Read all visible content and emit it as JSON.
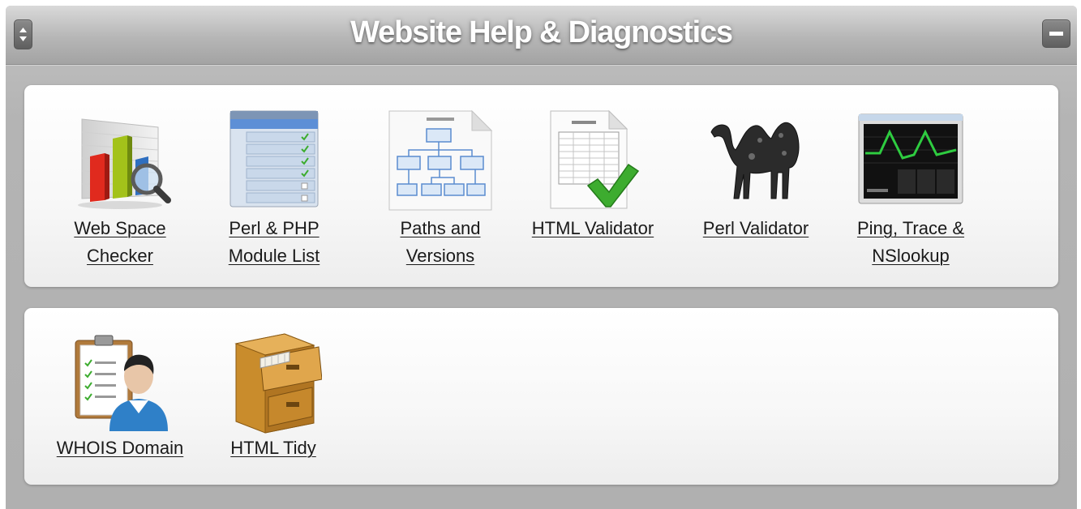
{
  "header": {
    "title": "Website Help & Diagnostics",
    "sort_icon": "up-down-arrows-icon",
    "minimize_icon": "minimize-icon"
  },
  "tools_row1": [
    {
      "line1": "Web Space",
      "line2": "Checker",
      "icon": "bar-chart-magnifier-icon"
    },
    {
      "line1": "Perl & PHP",
      "line2": "Module List",
      "icon": "module-list-icon"
    },
    {
      "line1": "Paths and",
      "line2": "Versions",
      "icon": "flowchart-document-icon"
    },
    {
      "line1": "HTML Validator",
      "line2": "",
      "icon": "checked-document-icon"
    },
    {
      "line1": "Perl Validator",
      "line2": "",
      "icon": "camel-icon"
    },
    {
      "line1": "Ping, Trace &",
      "line2": "NSlookup",
      "icon": "network-monitor-icon"
    }
  ],
  "tools_row2": [
    {
      "line1": "WHOIS Domain",
      "line2": "",
      "icon": "clipboard-person-icon"
    },
    {
      "line1": "HTML Tidy",
      "line2": "",
      "icon": "file-cabinet-icon"
    }
  ],
  "colors": {
    "titlebar": "#b6b6b6",
    "background": "#b4b4b4",
    "panel": "#f7f7f7",
    "link_text": "#1a1a1a",
    "check_green": "#3dac2f",
    "monitor_line": "#2ecc40"
  }
}
